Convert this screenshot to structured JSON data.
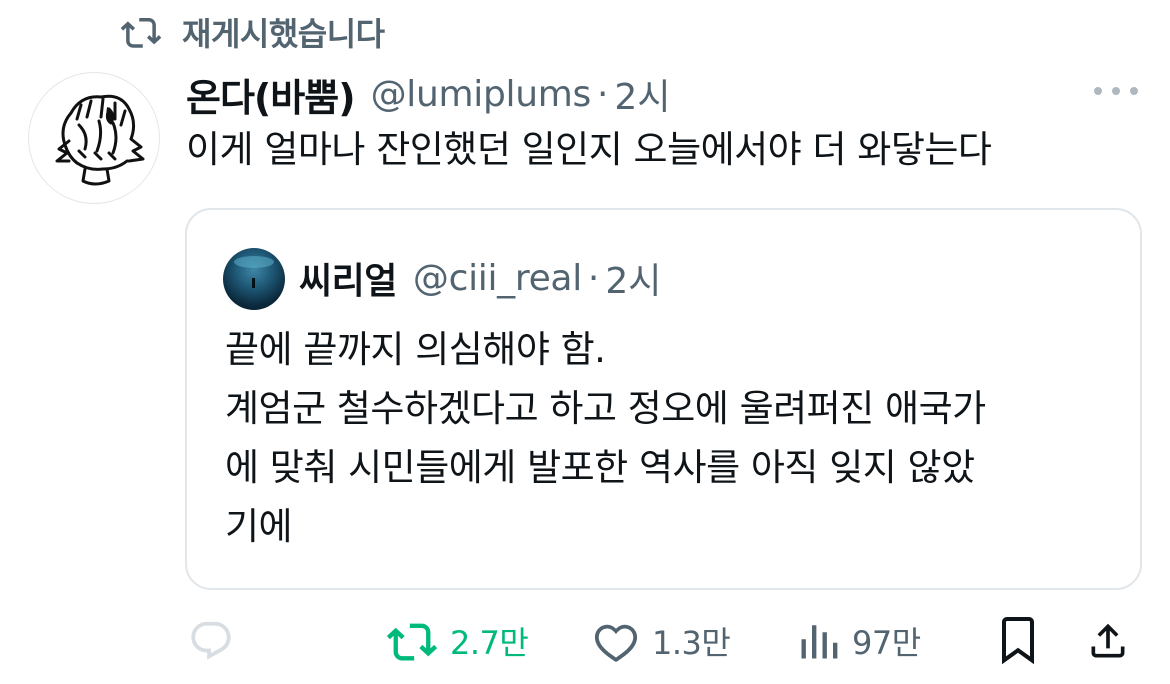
{
  "repost_banner": {
    "label": "재게시했습니다",
    "icon": "repost-icon"
  },
  "tweet": {
    "author_name": "온다(바뿜)",
    "handle": "@lumiplums",
    "separator": "·",
    "time": "2시",
    "text": "이게 얼마나 잔인했던 일인지 오늘에서야 더 와닿는다",
    "avatar_icon": "hand-drawn-avatar"
  },
  "quoted_tweet": {
    "author_name": "씨리얼",
    "handle": "@ciii_real",
    "separator": "·",
    "time": "2시",
    "lines": [
      "끝에 끝까지 의심해야 함.",
      "계엄군 철수하겠다고 하고 정오에 울려퍼진 애국가",
      "에 맞춰 시민들에게 발포한 역사를 아직 잊지 않았",
      "기에"
    ]
  },
  "actions": {
    "reply": {
      "icon": "reply-icon",
      "count": ""
    },
    "repost": {
      "icon": "repost-icon",
      "count": "2.7만",
      "active": true,
      "color": "#00ba7c"
    },
    "like": {
      "icon": "heart-icon",
      "count": "1.3만"
    },
    "views": {
      "icon": "views-icon",
      "count": "97만"
    },
    "bookmark": {
      "icon": "bookmark-icon"
    },
    "share": {
      "icon": "share-icon"
    }
  },
  "colors": {
    "secondary_text": "#536471",
    "primary_text": "#0f1419",
    "repost_green": "#00ba7c",
    "border": "#e1e6ea"
  }
}
